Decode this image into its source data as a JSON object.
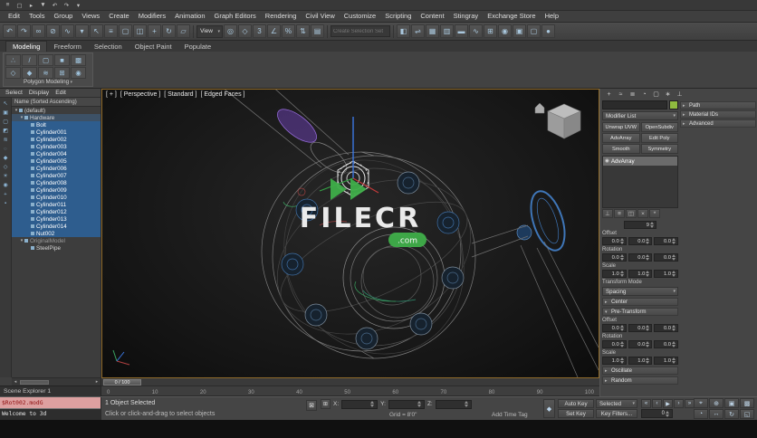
{
  "colors": {
    "accent_green": "#3fae49",
    "selection_blue": "#2e5d8e",
    "viewport_border": "#8f6a2a"
  },
  "qat": {
    "icons": [
      {
        "name": "application-menu-icon",
        "g": "≡"
      },
      {
        "name": "new-scene-icon",
        "g": "▢"
      },
      {
        "name": "open-file-icon",
        "g": "▸"
      },
      {
        "name": "save-file-icon",
        "g": "▼"
      },
      {
        "name": "undo-icon",
        "g": "↶"
      },
      {
        "name": "redo-icon",
        "g": "↷"
      },
      {
        "name": "workspace-dropdown-icon",
        "g": "▾"
      }
    ]
  },
  "menubar": {
    "items": [
      "Edit",
      "Tools",
      "Group",
      "Views",
      "Create",
      "Modifiers",
      "Animation",
      "Graph Editors",
      "Rendering",
      "Civil View",
      "Customize",
      "Scripting",
      "Content",
      "Stingray",
      "Exchange Store",
      "Help"
    ]
  },
  "toolbar": {
    "icons_a": [
      {
        "name": "undo-icon",
        "g": "↶"
      },
      {
        "name": "redo-icon",
        "g": "↷"
      },
      {
        "name": "select-and-link-icon",
        "g": "∞"
      },
      {
        "name": "unlink-selection-icon",
        "g": "⊘"
      },
      {
        "name": "bind-to-space-warp-icon",
        "g": "∿"
      },
      {
        "name": "selection-filter-dropdown",
        "g": "▾"
      },
      {
        "name": "select-object-icon",
        "g": "↖"
      },
      {
        "name": "select-by-name-icon",
        "g": "≡"
      },
      {
        "name": "selection-region-icon",
        "g": "▢"
      },
      {
        "name": "window-crossing-icon",
        "g": "◫"
      },
      {
        "name": "select-and-move-icon",
        "g": "+"
      },
      {
        "name": "select-and-rotate-icon",
        "g": "↻"
      },
      {
        "name": "select-and-scale-icon",
        "g": "▱"
      }
    ],
    "ref_coord": "View",
    "icons_b": [
      {
        "name": "use-pivot-center-icon",
        "g": "◎"
      },
      {
        "name": "select-and-manipulate-icon",
        "g": "◇"
      },
      {
        "name": "snaps-toggle-icon",
        "g": "3"
      },
      {
        "name": "angle-snap-icon",
        "g": "∠"
      },
      {
        "name": "percent-snap-icon",
        "g": "%"
      },
      {
        "name": "spinner-snap-icon",
        "g": "⇅"
      },
      {
        "name": "edit-named-selection-sets-icon",
        "g": "▤"
      }
    ],
    "selection_set_placeholder": "Create Selection Set",
    "icons_c": [
      {
        "name": "mirror-icon",
        "g": "◧"
      },
      {
        "name": "align-icon",
        "g": "⇌"
      },
      {
        "name": "toggle-scene-explorer-icon",
        "g": "▦"
      },
      {
        "name": "toggle-layer-explorer-icon",
        "g": "▥"
      },
      {
        "name": "toggle-ribbon-icon",
        "g": "▬"
      },
      {
        "name": "curve-editor-icon",
        "g": "∿"
      },
      {
        "name": "schematic-view-icon",
        "g": "⊞"
      },
      {
        "name": "material-editor-icon",
        "g": "◉"
      },
      {
        "name": "render-setup-icon",
        "g": "▣"
      },
      {
        "name": "rendered-frame-icon",
        "g": "▢"
      },
      {
        "name": "render-production-icon",
        "g": "●"
      }
    ]
  },
  "ribbon": {
    "tabs": [
      {
        "label": "Modeling",
        "active": true
      },
      {
        "label": "Freeform",
        "active": false
      },
      {
        "label": "Selection",
        "active": false
      },
      {
        "label": "Object Paint",
        "active": false
      },
      {
        "label": "Populate",
        "active": false
      }
    ],
    "group_label": "Polygon Modeling",
    "group_icons": [
      {
        "name": "vertex-mode-icon",
        "g": "∴"
      },
      {
        "name": "edge-mode-icon",
        "g": "/"
      },
      {
        "name": "border-mode-icon",
        "g": "▢"
      },
      {
        "name": "polygon-mode-icon",
        "g": "■"
      },
      {
        "name": "element-mode-icon",
        "g": "▩"
      },
      {
        "name": "preview-toggle-icon",
        "g": "◇"
      },
      {
        "name": "pm-extra-1-icon",
        "g": "◆"
      },
      {
        "name": "pm-extra-2-icon",
        "g": "≋"
      },
      {
        "name": "pm-extra-3-icon",
        "g": "⊞"
      },
      {
        "name": "pm-extra-4-icon",
        "g": "◉"
      }
    ]
  },
  "scene_explorer": {
    "menus": [
      "Select",
      "Display",
      "Edit"
    ],
    "column_header": "Name (Sorted Ascending)",
    "title": "Scene Explorer 1",
    "tools": [
      {
        "name": "explorer-pick-icon",
        "g": "↖"
      },
      {
        "name": "explorer-select-all-icon",
        "g": "▣"
      },
      {
        "name": "explorer-select-none-icon",
        "g": "▢"
      },
      {
        "name": "explorer-select-invert-icon",
        "g": "◩"
      },
      {
        "name": "explorer-select-children-icon",
        "g": "≋"
      },
      {
        "name": "explorer-find-icon",
        "g": "◌"
      },
      {
        "name": "explorer-display-geometry-icon",
        "g": "◆"
      },
      {
        "name": "explorer-display-shapes-icon",
        "g": "◇"
      },
      {
        "name": "explorer-display-lights-icon",
        "g": "☀"
      },
      {
        "name": "explorer-display-cameras-icon",
        "g": "◉"
      },
      {
        "name": "explorer-display-helpers-icon",
        "g": "+"
      },
      {
        "name": "explorer-lock-icon",
        "g": "▪"
      }
    ],
    "items": [
      {
        "label": "(default)",
        "ind": "2px",
        "arrow": "▾"
      },
      {
        "label": "Hardware",
        "ind": "8px",
        "arrow": "▾",
        "hl": true
      },
      {
        "label": "Bolt",
        "ind": "15px",
        "selected": true
      },
      {
        "label": "Cylinder001",
        "ind": "15px",
        "selected": true
      },
      {
        "label": "Cylinder002",
        "ind": "15px",
        "selected": true
      },
      {
        "label": "Cylinder003",
        "ind": "15px",
        "selected": true
      },
      {
        "label": "Cylinder004",
        "ind": "15px",
        "selected": true
      },
      {
        "label": "Cylinder005",
        "ind": "15px",
        "selected": true
      },
      {
        "label": "Cylinder006",
        "ind": "15px",
        "selected": true
      },
      {
        "label": "Cylinder007",
        "ind": "15px",
        "selected": true
      },
      {
        "label": "Cylinder008",
        "ind": "15px",
        "selected": true
      },
      {
        "label": "Cylinder009",
        "ind": "15px",
        "selected": true
      },
      {
        "label": "Cylinder010",
        "ind": "15px",
        "selected": true
      },
      {
        "label": "Cylinder011",
        "ind": "15px",
        "selected": true
      },
      {
        "label": "Cylinder012",
        "ind": "15px",
        "selected": true
      },
      {
        "label": "Cylinder013",
        "ind": "15px",
        "selected": true
      },
      {
        "label": "Cylinder014",
        "ind": "15px",
        "selected": true
      },
      {
        "label": "Nut002",
        "ind": "15px",
        "selected": true
      },
      {
        "label": "OriginalModel",
        "ind": "8px",
        "arrow": "▾",
        "muted": true
      },
      {
        "label": "SteelPipe",
        "ind": "15px"
      }
    ]
  },
  "viewport": {
    "labels": [
      "[ + ]",
      "[ Perspective ]",
      "[ Standard ]",
      "[ Edged Faces ]"
    ],
    "watermark_title": "FILECR",
    "watermark_badge": ".com"
  },
  "command_panel": {
    "tabs": [
      {
        "name": "create-tab-icon",
        "g": "+"
      },
      {
        "name": "modify-tab-icon",
        "g": "≈"
      },
      {
        "name": "hierarchy-tab-icon",
        "g": "≣"
      },
      {
        "name": "motion-tab-icon",
        "g": "◔"
      },
      {
        "name": "display-tab-icon",
        "g": "▢"
      },
      {
        "name": "utilities-tab-icon",
        "g": "∗"
      },
      {
        "name": "pin-panel-icon",
        "g": "⊥"
      }
    ],
    "object_color": "#8fbc3f",
    "modifier_list_label": "Modifier List",
    "modifier_buttons": [
      "Unwrap UVW",
      "OpenSubdiv",
      "AdvArray",
      "Edit Poly",
      "Smooth",
      "Symmetry"
    ],
    "stack": [
      {
        "icon": "◉",
        "label": "AdvArray"
      }
    ],
    "stack_tools": [
      {
        "name": "pin-stack-icon",
        "g": "⊥"
      },
      {
        "name": "show-end-result-icon",
        "g": "≡"
      },
      {
        "name": "make-unique-icon",
        "g": "◫"
      },
      {
        "name": "remove-modifier-icon",
        "g": "×"
      },
      {
        "name": "configure-modifier-sets-icon",
        "g": "*"
      }
    ],
    "rollouts_right": [
      "Path",
      "Material IDs",
      "Advanced"
    ],
    "params": {
      "count_value": "9",
      "offset_label": "Offset",
      "offset": [
        "0.0",
        "0.0",
        "0.0"
      ],
      "rotation_label": "Rotation",
      "rotation": [
        "0.0",
        "0.0",
        "0.0"
      ],
      "scale_label": "Scale",
      "scale": [
        "1.0",
        "1.0",
        "1.0"
      ],
      "transform_mode_label": "Transform Mode",
      "transform_mode_value": "Spacing",
      "center_label": "Center",
      "pretransform_label": "Pre-Transform",
      "offset2_label": "Offset",
      "offset2": [
        "0.0",
        "0.0",
        "0.0"
      ],
      "rotation2_label": "Rotation",
      "rotation2": [
        "0.0",
        "0.0",
        "0.0"
      ],
      "scale2_label": "Scale",
      "scale2": [
        "1.0",
        "1.0",
        "1.0"
      ],
      "oscillate_label": "Oscillate",
      "random_label": "Random"
    }
  },
  "timeline": {
    "slider": "0 / 100",
    "ticks": [
      "0",
      "10",
      "20",
      "30",
      "40",
      "50",
      "60",
      "70",
      "80",
      "90",
      "100"
    ]
  },
  "status_bar": {
    "listener": {
      "macro_line": "$Rot002.modG",
      "listener_line": "Welcome to 3d"
    },
    "selection_status": "1 Object Selected",
    "prompt": "Click or click-and-drag to select objects",
    "coords": {
      "x_label": "X:",
      "y_label": "Y:",
      "z_label": "Z:",
      "x": "",
      "y": "",
      "z": ""
    },
    "grid_label": "Grid = 8'0\"",
    "add_time_tag": "Add Time Tag",
    "auto_key": "Auto Key",
    "selection_set": "Selected",
    "set_key": "Set Key",
    "key_filters": "Key Filters...",
    "frame_field": "0",
    "playback": [
      {
        "name": "go-to-start-icon",
        "g": "«"
      },
      {
        "name": "previous-frame-icon",
        "g": "‹"
      },
      {
        "name": "play-icon",
        "g": "▶"
      },
      {
        "name": "next-frame-icon",
        "g": "›"
      },
      {
        "name": "go-to-end-icon",
        "g": "»"
      }
    ],
    "nav_icons": [
      {
        "name": "zoom-icon",
        "g": "⌖"
      },
      {
        "name": "zoom-all-icon",
        "g": "⊕"
      },
      {
        "name": "zoom-extents-icon",
        "g": "▣"
      },
      {
        "name": "zoom-extents-all-icon",
        "g": "▩"
      },
      {
        "name": "field-of-view-icon",
        "g": "◔"
      },
      {
        "name": "pan-icon",
        "g": "↔"
      },
      {
        "name": "orbit-icon",
        "g": "↻"
      },
      {
        "name": "maximize-viewport-icon",
        "g": "◱"
      }
    ]
  }
}
